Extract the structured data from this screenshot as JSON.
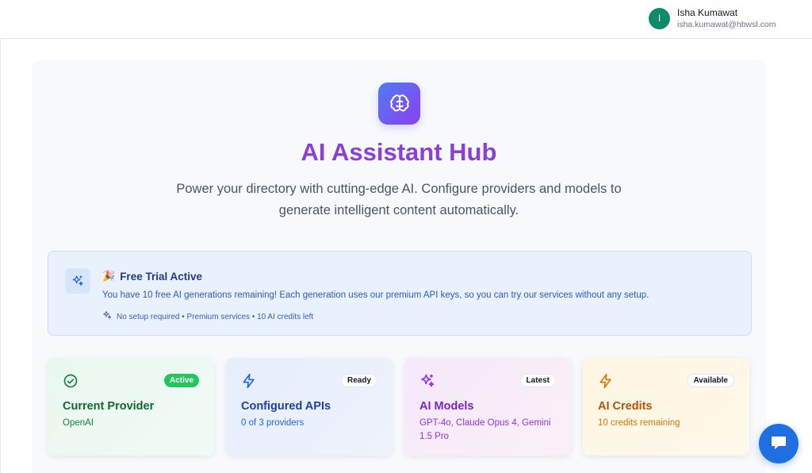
{
  "user": {
    "avatar_initial": "I",
    "name": "Isha Kumawat",
    "email": "isha.kumawat@hbwsl.com"
  },
  "hero": {
    "icon": "brain-icon",
    "title": "AI Assistant Hub",
    "subtitle": "Power your directory with cutting-edge AI. Configure providers and models to generate intelligent content automatically."
  },
  "trial": {
    "icon": "sparkles-icon",
    "emoji": "🎉",
    "title": "Free Trial Active",
    "description": "You have 10 free AI generations remaining! Each generation uses our premium API keys, so you can try our services without any setup.",
    "meta": "No setup required • Premium services • 10 AI credits left"
  },
  "cards": [
    {
      "icon": "check-circle-icon",
      "badge": "Active",
      "title": "Current Provider",
      "subtitle": "OpenAI",
      "accent": "#22c55e"
    },
    {
      "icon": "lightning-icon",
      "badge": "Ready",
      "title": "Configured APIs",
      "subtitle": "0 of 3 providers",
      "accent": "#2563eb"
    },
    {
      "icon": "sparkles-icon",
      "badge": "Latest",
      "title": "AI Models",
      "subtitle": "GPT-4o, Claude Opus 4, Gemini 1.5 Pro",
      "accent": "#9333ea"
    },
    {
      "icon": "lightning-icon",
      "badge": "Available",
      "title": "AI Credits",
      "subtitle": "10 credits remaining",
      "accent": "#d97706"
    }
  ],
  "chat": {
    "icon": "chat-bubble-icon"
  },
  "colors": {
    "brand_purple": "#8b3fd9",
    "brand_blue": "#1f6fe0",
    "avatar": "#0f8a6b"
  }
}
